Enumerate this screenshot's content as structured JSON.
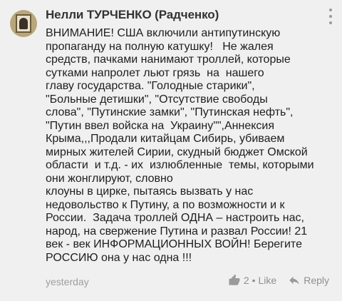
{
  "comment": {
    "author": "Нелли ТУРЧЕНКО (Радченко)",
    "avatar_icon": "avatar-image",
    "menu_icon": "more-vertical-icon",
    "lines": [
      "ВНИМАНИЕ! США включили антипутинскую",
      "пропаганду на полную катушку!   Не жалея",
      "средств, пачками нанимают троллей, которые",
      "сутками напролет льют грязь  на  нашего",
      "главу государства. \"Голодные старики\",",
      "\"Больные детишки\", \"Отсутствие свободы",
      "слова\", \"Путинские замки\", \"Путинская нефть\",",
      "\"Путин ввел войска на  Украину\"\",Аннексия",
      "Крыма,,,Продали китайцам Сибирь, убиваем",
      "мирных жителей Сирии, скудный бюджет Омской",
      "области  и т.д. - их  излюбленные  темы, которыми",
      "они жонглируют, словно",
      "клоуны в цирке, пытаясь вызвать у нас",
      "недовольство к Путину, а по возможности и к",
      "России.  Задача троллей ОДНА – настроить нас,",
      "народ, на свержение Путина и развал России! 21",
      "век - век ИНФОРМАЦИОННЫХ ВОЙН! Берегите",
      "РОССИЮ она у нас одна !!!"
    ],
    "timestamp": "yesterday",
    "likes_count": "2",
    "separator": "•",
    "like_label": "Like",
    "reply_label": "Reply"
  }
}
